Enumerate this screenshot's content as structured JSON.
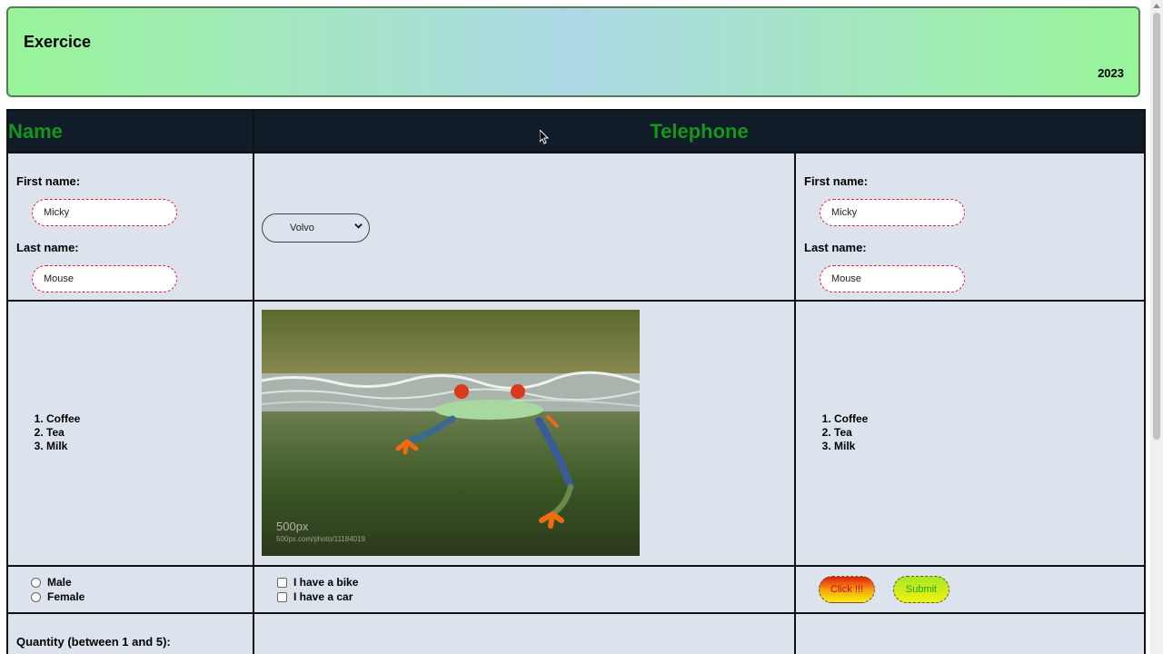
{
  "header": {
    "title": "Exercice",
    "year": "2023"
  },
  "table": {
    "headers": {
      "name": "Name",
      "telephone": "Telephone"
    },
    "form_left": {
      "first_name_label": "First name:",
      "first_name_value": "Micky",
      "last_name_label": "Last name:",
      "last_name_value": "Mouse"
    },
    "form_right": {
      "first_name_label": "First name:",
      "first_name_value": "Micky",
      "last_name_label": "Last name:",
      "last_name_value": "Mouse"
    },
    "select": {
      "selected": "Volvo"
    },
    "list_left": [
      "Coffee",
      "Tea",
      "Milk"
    ],
    "list_right": [
      "Coffee",
      "Tea",
      "Milk"
    ],
    "image": {
      "watermark": "500px",
      "caption": "500px.com/photo/11184019"
    },
    "radios": {
      "male": "Male",
      "female": "Female"
    },
    "checkboxes": {
      "bike": "I have a bike",
      "car": "I have a car"
    },
    "buttons": {
      "click": "Click !!!",
      "submit": "Submit"
    },
    "quantity_label": "Quantity (between 1 and 5):"
  },
  "colors": {
    "header_gradient_edge": "#98f598",
    "header_gradient_center": "#add8e6",
    "table_header_bg": "#101c28",
    "table_header_text": "#17961c",
    "cell_bg": "#dce3ec",
    "input_border": "#e0203c"
  },
  "icons": {
    "select_arrow": "chevron-down-icon",
    "cursor": "mouse-pointer-icon"
  }
}
